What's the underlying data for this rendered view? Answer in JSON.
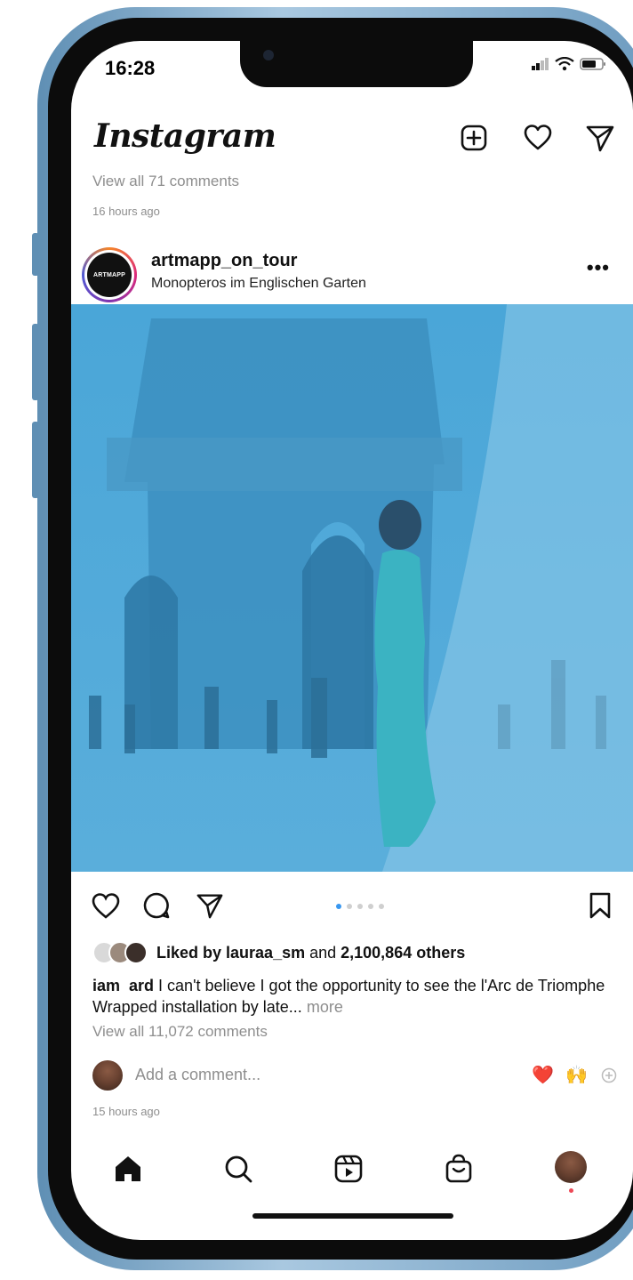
{
  "status_bar": {
    "time": "16:28"
  },
  "header": {
    "logo": "Instagram",
    "icons": [
      "add-post-icon",
      "heart-icon",
      "direct-message-icon"
    ]
  },
  "previous_post": {
    "view_comments": "View all 71 comments",
    "timestamp": "16 hours ago"
  },
  "post": {
    "username": "artmapp_on_tour",
    "location": "Monopteros im Englischen Garten",
    "avatar_text": "ARTMAPP",
    "carousel": {
      "total": 5,
      "current": 1
    },
    "liked_by_prefix": "Liked by ",
    "liked_by_user": "lauraa_sm",
    "liked_by_suffix": " and ",
    "liked_by_count": "2,100,864 others",
    "caption_user": "iam  ard",
    "caption_text": "I can't believe I got the opportunity to see the l'Arc de Triomphe Wrapped installation by late...",
    "caption_more": "more",
    "view_comments": "View all 11,072 comments",
    "add_comment_placeholder": "Add a comment...",
    "quick_emojis": [
      "❤️",
      "🙌"
    ],
    "timestamp": "15 hours ago"
  },
  "tab_bar": {
    "items": [
      "home-icon",
      "search-icon",
      "reels-icon",
      "shop-icon",
      "profile-avatar"
    ]
  },
  "colors": {
    "accent": "#3897f0",
    "photo_overlay": "#4aa6d8",
    "muted_text": "#8e8e8e",
    "notification_dot": "#ed4956"
  }
}
